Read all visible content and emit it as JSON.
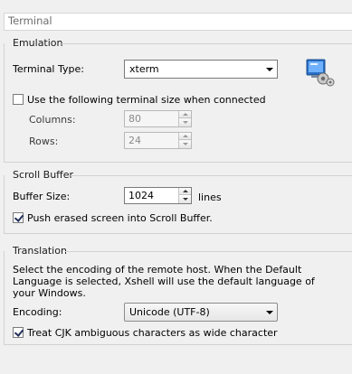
{
  "page": {
    "title": "Terminal"
  },
  "emulation": {
    "group_label": "Emulation",
    "terminal_type_label": "Terminal Type:",
    "terminal_type_value": "xterm",
    "use_size_label": "Use the following terminal size when connected",
    "use_size_checked": false,
    "columns_label": "Columns:",
    "columns_value": "80",
    "rows_label": "Rows:",
    "rows_value": "24",
    "icon": "terminal-settings-icon"
  },
  "scroll_buffer": {
    "group_label": "Scroll Buffer",
    "buffer_size_label": "Buffer Size:",
    "buffer_size_value": "1024",
    "buffer_units": "lines",
    "push_erased_label": "Push erased screen into Scroll Buffer.",
    "push_erased_checked": true
  },
  "translation": {
    "group_label": "Translation",
    "description": "Select the encoding of the remote host. When the Default Language is selected, Xshell will use the default language of your Windows.",
    "encoding_label": "Encoding:",
    "encoding_value": "Unicode (UTF-8)",
    "cjk_label": "Treat CJK ambiguous characters as wide character",
    "cjk_checked": true
  },
  "colors": {
    "accent_check": "#1f2f5a",
    "icon_blue": "#2a6fc4"
  }
}
